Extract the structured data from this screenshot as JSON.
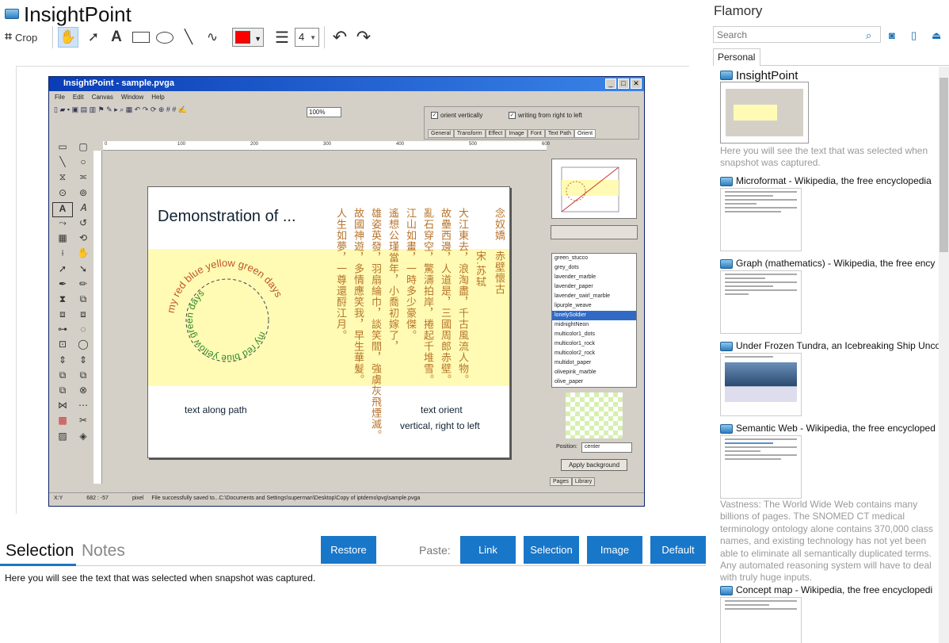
{
  "app": {
    "title": "InsightPoint"
  },
  "toolbar": {
    "crop_label": "Crop",
    "line_size": "4"
  },
  "screenshot": {
    "window_title": "InsightPoint - sample.pvga",
    "menu": [
      "File",
      "Edit",
      "Canvas",
      "Window",
      "Help"
    ],
    "zoom": "100%",
    "orient_vertically": "orient vertically",
    "writing_rtl": "writing from right to left",
    "tabs": [
      "General",
      "Transform",
      "Effect",
      "Image",
      "Font",
      "Text Path",
      "Orient"
    ],
    "ruler_marks": [
      "0",
      "100",
      "200",
      "300",
      "400",
      "500",
      "600"
    ],
    "doc_title": "Demonstration of ...",
    "caption_path": "text along path",
    "caption_orient": "text orient",
    "caption_orient2": "vertical, right to left",
    "circle_outer": "my red blue yellow green days",
    "circle_inner": "my red blue yellow green days",
    "poem_cols": [
      "念奴嬌",
      "赤壁懷古",
      "宋.苏轼",
      "大江東去，浪淘盡，千古風流人物。",
      "故壘西邊，人道是，三國周郎赤壁。",
      "亂石穿空，驚濤拍岸，捲起千堆雪。",
      "江山如畫，一時多少豪傑。",
      "遙想公瑾當年，小喬初嫁了，",
      "雄姿英發，羽扇綸巾，談笑間，強虜灰飛煙滅。",
      "故國神遊，多情應笑我，早生華髮。",
      "人生如夢，一尊還酹江月。"
    ],
    "list_items": [
      "green_stucco",
      "grey_dots",
      "lavender_marble",
      "lavender_paper",
      "lavender_swirl_marble",
      "lipurple_weave",
      "lonelySoldier",
      "midnightNeon",
      "multicolor1_dots",
      "multicolor1_rock",
      "multicolor2_rock",
      "multidot_paper",
      "olivepink_marble",
      "olive_paper",
      "orange_paper"
    ],
    "selected_item": "lonelySoldier",
    "position_label": "Position:",
    "position_value": "center",
    "apply_button": "Apply  background",
    "bottom_tabs": [
      "Pages",
      "Library"
    ],
    "status_xy": "X:Y",
    "status_coords": "682 : -57",
    "status_unit": "pixel",
    "status_message": "File successfully saved to...C:\\Documents and Settings\\superman\\Desktop\\Copy of iptdemo\\pvg\\sample.pvga"
  },
  "bottom": {
    "tab_selection": "Selection",
    "tab_notes": "Notes",
    "restore": "Restore",
    "paste_label": "Paste:",
    "link": "Link",
    "selection": "Selection",
    "image": "Image",
    "default": "Default",
    "note_text": "Here you will see the text that was selected when snapshot was captured."
  },
  "sidebar": {
    "title": "Flamory",
    "search_placeholder": "Search",
    "tab_personal": "Personal",
    "items": [
      {
        "title": "InsightPoint",
        "desc": "Here you will see the text that was selected when snapshot was captured."
      },
      {
        "title": "Microformat - Wikipedia, the free encyclopedia"
      },
      {
        "title": "Graph (mathematics) - Wikipedia, the free ency"
      },
      {
        "title": "Under Frozen Tundra, an Icebreaking Ship Unco"
      },
      {
        "title": "Semantic Web - Wikipedia, the free encycloped",
        "desc": "Vastness: The World Wide Web contains many billions of pages. The SNOMED CT medical terminology ontology alone contains 370,000 class names, and existing technology has not yet been able to eliminate all semantically duplicated terms. Any automated reasoning system will have to deal with truly huge inputs."
      },
      {
        "title": "Concept map - Wikipedia, the free encyclopedi"
      }
    ]
  },
  "colors": {
    "accent": "#1877c9",
    "stroke_color": "#ff0000",
    "highlight": "#fffbb4"
  }
}
